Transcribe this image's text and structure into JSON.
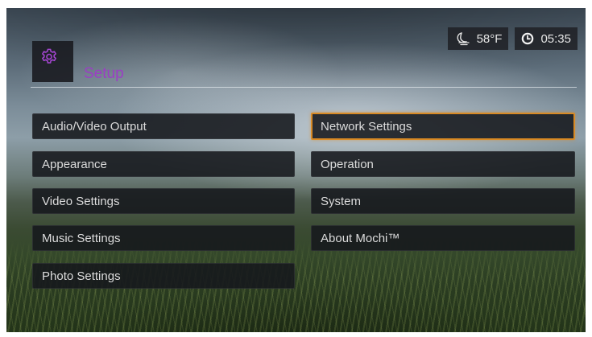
{
  "status": {
    "temperature": "58°F",
    "time": "05:35",
    "weather_icon": "weather-night-icon",
    "clock_icon": "clock-icon"
  },
  "header": {
    "icon": "gear-icon",
    "title": "Setup",
    "accent_color": "#9b3fc4"
  },
  "menu": {
    "left": [
      {
        "label": "Audio/Video Output"
      },
      {
        "label": "Appearance"
      },
      {
        "label": "Video Settings"
      },
      {
        "label": "Music Settings"
      },
      {
        "label": "Photo Settings"
      }
    ],
    "right": [
      {
        "label": "Network Settings",
        "selected": true
      },
      {
        "label": "Operation"
      },
      {
        "label": "System"
      },
      {
        "label": "About Mochi™"
      }
    ],
    "selection_color": "#d88a25"
  }
}
